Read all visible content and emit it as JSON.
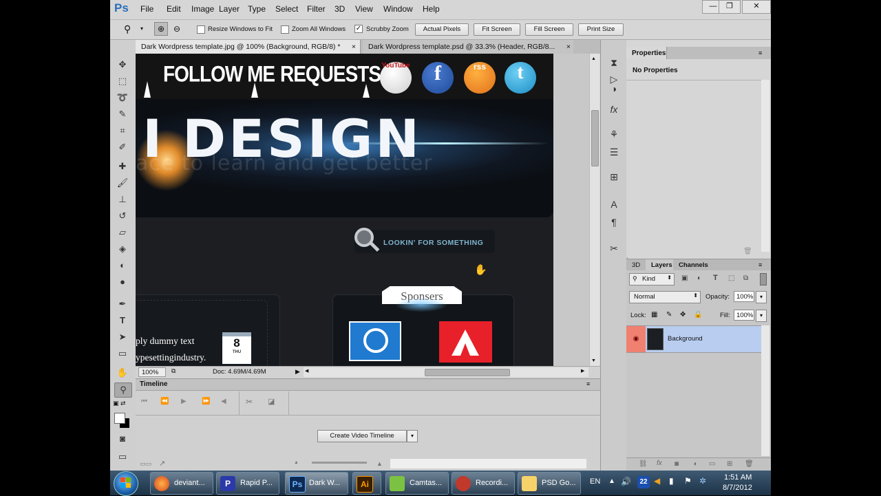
{
  "app": {
    "logo": "Ps"
  },
  "menu": [
    "File",
    "Edit",
    "Image",
    "Layer",
    "Type",
    "Select",
    "Filter",
    "3D",
    "View",
    "Window",
    "Help"
  ],
  "window_controls": {
    "minimize": "—",
    "restore": "❐",
    "close": "✕"
  },
  "options_bar": {
    "resize_windows": "Resize Windows to Fit",
    "zoom_all": "Zoom All Windows",
    "scrubby_zoom": "Scrubby Zoom",
    "actual_pixels": "Actual Pixels",
    "fit_screen": "Fit Screen",
    "fill_screen": "Fill Screen",
    "print_size": "Print Size",
    "scrubby_checked": true
  },
  "tabs": [
    {
      "label": "Dark Wordpress template.jpg @ 100% (Background, RGB/8) *",
      "close": "×"
    },
    {
      "label": "Dark Wordpress template.psd @ 33.3% (Header, RGB/8...",
      "close": "×"
    }
  ],
  "canvas": {
    "nav": [
      "FOLLOW ME",
      "REQUESTS"
    ],
    "social": [
      "YouTube",
      "f",
      "rss",
      "t"
    ],
    "banner_title": "DESIGN",
    "banner_partial": "I",
    "banner_tagline": "ace to learn and get better",
    "search_text": "LOOKIN' FOR SOMETHING",
    "sponsors_title": "Sponsers",
    "dummy_line1": "ply dummy text",
    "dummy_line2": "ypesettingindustry.",
    "calendar_day": "8",
    "calendar_month": "THU"
  },
  "status": {
    "zoom": "100%",
    "doc": "Doc: 4.69M/4.69M"
  },
  "timeline": {
    "title": "Timeline",
    "create_button": "Create Video Timeline"
  },
  "properties": {
    "tab": "Properties",
    "body": "No Properties"
  },
  "layers_panel": {
    "tabs": [
      "3D",
      "Layers",
      "Channels"
    ],
    "kind": "Kind",
    "blend": "Normal",
    "opacity_label": "Opacity:",
    "opacity": "100%",
    "lock_label": "Lock:",
    "fill_label": "Fill:",
    "fill": "100%",
    "layer_name": "Background"
  },
  "taskbar": {
    "items": [
      {
        "label": "deviant...",
        "icon": "firefox-icon"
      },
      {
        "label": "Rapid P...",
        "icon": "P"
      },
      {
        "label": "Dark W...",
        "icon": "Ps"
      },
      {
        "label": "",
        "icon": "Ai"
      },
      {
        "label": "Camtas...",
        "icon": "camtasia-icon"
      },
      {
        "label": "Recordi...",
        "icon": "recording-icon"
      },
      {
        "label": "PSD Go...",
        "icon": "folder-icon"
      }
    ],
    "lang": "EN",
    "tray_num": "22",
    "time": "1:51 AM",
    "date": "8/7/2012"
  },
  "colors": {
    "accent": "#2b6fb8",
    "selected_layer": "#b8cdf0",
    "eye": "#f08070"
  }
}
